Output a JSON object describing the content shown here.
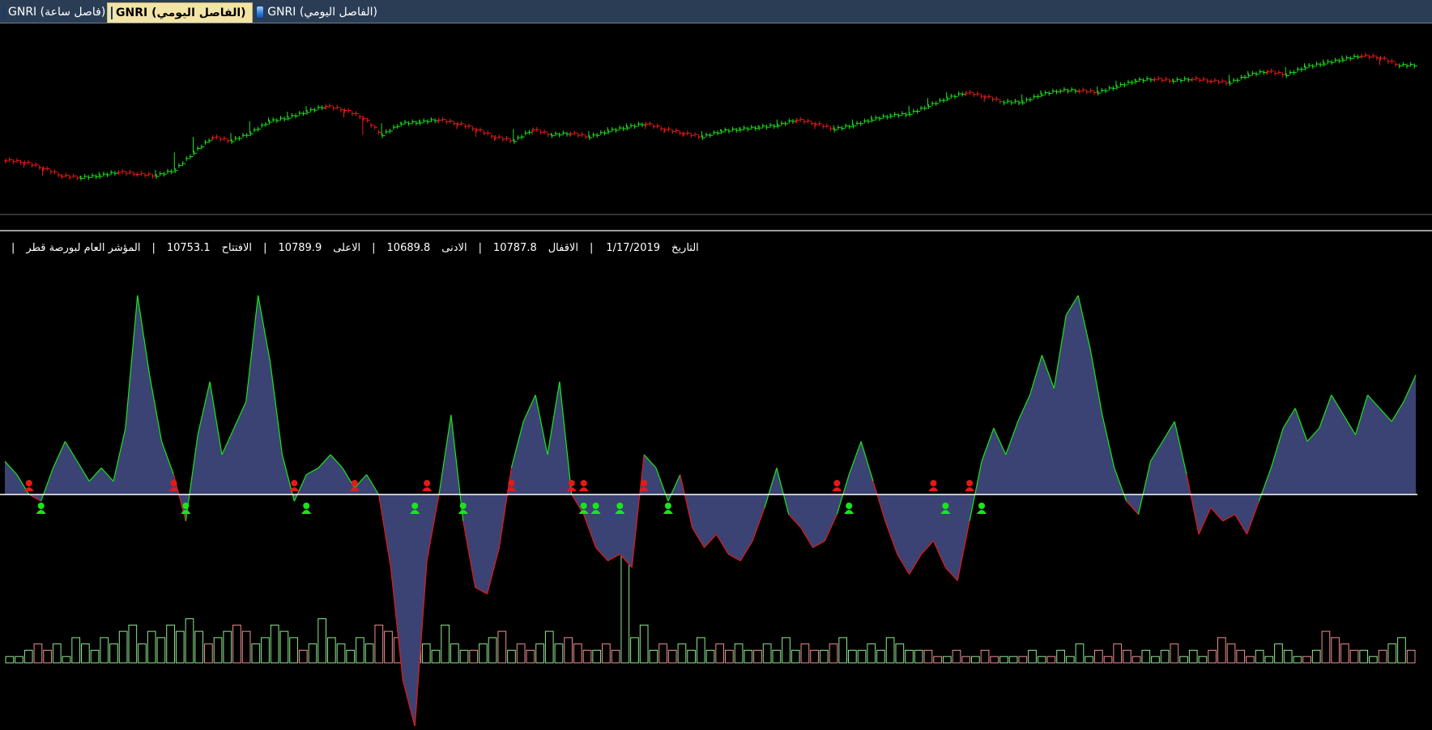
{
  "tabs": [
    {
      "label": "GNRI (فاصل ساعة)",
      "active": false,
      "closable": false
    },
    {
      "label": "GNRI (الفاصل اليومي)",
      "active": true,
      "closable": true
    },
    {
      "label": "GNRI (الفاصل اليومي)",
      "active": false,
      "closable": false
    }
  ],
  "info": {
    "date_label": "التاريخ",
    "date_value": "1/17/2019",
    "close_label": "الاقفال",
    "close_value": "10787.8",
    "low_label": "الادنى",
    "low_value": "10689.8",
    "high_label": "الاعلى",
    "high_value": "10789.9",
    "open_label": "الافتتاح",
    "open_value": "10753.1",
    "index_name": "المؤشر العام لبورصة قطر"
  },
  "colors": {
    "up": "#19e619",
    "down": "#e61919",
    "area": "#3a4373",
    "zero_line": "#ffffff",
    "panel_border": "#ffffff"
  },
  "icons": {
    "tab": "chart-db-icon",
    "buy": "buy-person-icon",
    "sell": "sell-person-icon",
    "close": "close-icon"
  },
  "chart_data": [
    {
      "type": "line",
      "title": "",
      "series": [
        {
          "values": [
            10640,
            10635,
            10620,
            10600,
            10595,
            10600,
            10610,
            10605,
            10600,
            10615,
            10660,
            10700,
            10690,
            10710,
            10740,
            10750,
            10765,
            10780,
            10770,
            10750,
            10705,
            10735,
            10738,
            10745,
            10735,
            10720,
            10700,
            10690,
            10720,
            10705,
            10710,
            10700,
            10715,
            10725,
            10735,
            10720,
            10710,
            10700,
            10715,
            10720,
            10725,
            10730,
            10745,
            10735,
            10720,
            10730,
            10745,
            10755,
            10760,
            10780,
            10800,
            10815,
            10805,
            10790,
            10790,
            10810,
            10820,
            10820,
            10815,
            10830,
            10845,
            10850,
            10845,
            10850,
            10845,
            10840,
            10860,
            10870,
            10860,
            10880,
            10890,
            10900,
            10910,
            10905,
            10885,
            10885
          ]
        }
      ]
    },
    {
      "type": "area",
      "title": "",
      "series": [
        {
          "values": [
            5,
            3,
            0,
            -1,
            4,
            8,
            5,
            2,
            4,
            2,
            10,
            30,
            18,
            8,
            3,
            -4,
            9,
            17,
            6,
            10,
            14,
            30,
            20,
            6,
            -1,
            3,
            4,
            6,
            4,
            1,
            3,
            0,
            -11,
            -28,
            -35,
            -10,
            0,
            12,
            -4,
            -14,
            -15,
            -8,
            4,
            11,
            15,
            6,
            17,
            0,
            -3,
            -8,
            -10,
            -9,
            -11,
            6,
            4,
            -1,
            3,
            -5,
            -8,
            -6,
            -9,
            -10,
            -7,
            -2,
            4,
            -3,
            -5,
            -8,
            -7,
            -3,
            3,
            8,
            2,
            -4,
            -9,
            -12,
            -9,
            -7,
            -11,
            -13,
            -4,
            5,
            10,
            6,
            11,
            15,
            21,
            16,
            27,
            30,
            22,
            12,
            4,
            -1,
            -3,
            5,
            8,
            11,
            3,
            -6,
            -2,
            -4,
            -3,
            -6,
            -1,
            4,
            10,
            13,
            8,
            10,
            15,
            12,
            9,
            15,
            13,
            11,
            14,
            18
          ]
        }
      ],
      "signals": {
        "sell_index": [
          2,
          14,
          24,
          29,
          35,
          42,
          47,
          48,
          53,
          69,
          77,
          80
        ],
        "buy_index": [
          3,
          15,
          25,
          34,
          38,
          48,
          49,
          51,
          55,
          70,
          78,
          81
        ]
      }
    },
    {
      "type": "bar",
      "title": "",
      "series": [
        {
          "values": [
            1,
            1,
            2,
            3,
            2,
            3,
            1,
            4,
            3,
            2,
            4,
            3,
            5,
            6,
            3,
            5,
            4,
            6,
            5,
            7,
            5,
            3,
            4,
            5,
            6,
            5,
            3,
            4,
            6,
            5,
            4,
            2,
            3,
            7,
            4,
            3,
            2,
            4,
            3,
            6,
            5,
            4,
            3,
            2,
            3,
            2,
            6,
            3,
            2,
            2,
            3,
            4,
            5,
            2,
            3,
            2,
            3,
            5,
            3,
            4,
            3,
            2,
            2,
            3,
            2,
            18,
            4,
            6,
            2,
            3,
            2,
            3,
            2,
            4,
            2,
            3,
            2,
            3,
            2,
            2,
            3,
            2,
            4,
            2,
            3,
            2,
            2,
            3,
            4,
            2,
            2,
            3,
            2,
            4,
            3,
            2,
            2,
            2,
            1,
            1,
            2,
            1,
            1,
            2,
            1,
            1,
            1,
            1,
            2,
            1,
            1,
            2,
            1,
            3,
            1,
            2,
            1,
            3,
            2,
            1,
            2,
            1,
            2,
            3,
            1,
            2,
            1,
            2,
            4,
            3,
            2,
            1,
            2,
            1,
            3,
            2,
            1,
            1,
            2,
            5,
            4,
            3,
            2,
            2,
            1,
            2,
            3,
            4,
            2
          ]
        }
      ]
    }
  ]
}
